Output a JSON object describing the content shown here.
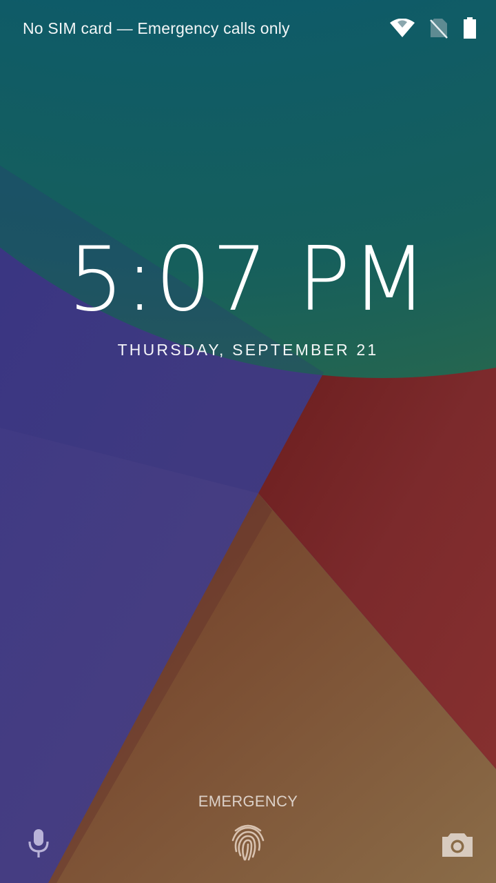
{
  "status_bar": {
    "carrier_text": "No SIM card — Emergency calls only",
    "icons": [
      "wifi-icon",
      "no-sim-icon",
      "battery-icon"
    ]
  },
  "lockscreen": {
    "time": "5:07 PM",
    "date": "THURSDAY, SEPTEMBER 21",
    "emergency_label": "EMERGENCY"
  },
  "bottom_actions": [
    "mic-icon",
    "fingerprint-icon",
    "camera-icon"
  ],
  "colors": {
    "teal": "#0b5566",
    "purple": "#4a3b80",
    "red": "#7a2428",
    "orange": "#7c5a3c"
  }
}
